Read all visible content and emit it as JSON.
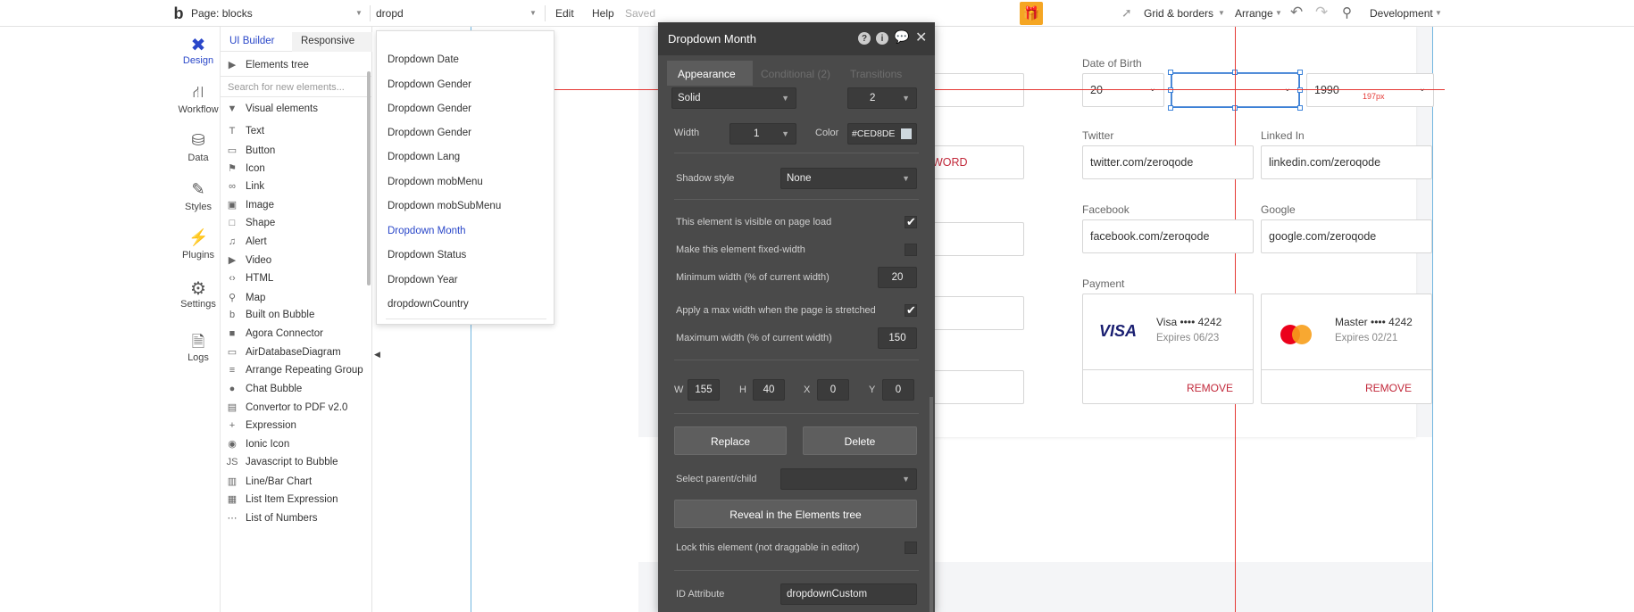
{
  "topbar": {
    "page_label": "Page: blocks",
    "search_value": "dropd",
    "edit": "Edit",
    "help": "Help",
    "saved": "Saved",
    "grid_borders": "Grid & borders",
    "arrange": "Arrange",
    "development": "Development"
  },
  "rail": {
    "items": [
      "Design",
      "Workflow",
      "Data",
      "Styles",
      "Plugins",
      "Settings",
      "Logs"
    ]
  },
  "panel": {
    "tabs": [
      "UI Builder",
      "Responsive"
    ],
    "elements_tree": "Elements tree",
    "search_placeholder": "Search for new elements...",
    "visual_elements": "Visual elements",
    "items": [
      "Text",
      "Button",
      "Icon",
      "Link",
      "Image",
      "Shape",
      "Alert",
      "Video",
      "HTML",
      "Map",
      "Built on Bubble",
      "Agora Connector",
      "AirDatabaseDiagram",
      "Arrange Repeating Group",
      "Chat Bubble",
      "Convertor to PDF v2.0",
      "Expression",
      "Ionic Icon",
      "Javascript to Bubble",
      "Line/Bar Chart",
      "List Item Expression",
      "List of Numbers"
    ]
  },
  "dropdown_list": {
    "items": [
      "Dropdown Date",
      "Dropdown Gender",
      "Dropdown Gender",
      "Dropdown Gender",
      "Dropdown Lang",
      "Dropdown mobMenu",
      "Dropdown mobSubMenu",
      "Dropdown Month",
      "Dropdown Status",
      "Dropdown Year",
      "dropdownCountry"
    ],
    "selected_index": 7
  },
  "canvas": {
    "dob_label": "Date of Birth",
    "dob_day": "20",
    "dob_year": "1990",
    "measure": "197px",
    "password_fragment": "ASSWORD",
    "twitter_label": "Twitter",
    "twitter_value": "twitter.com/zeroqode",
    "linkedin_label": "Linked In",
    "linkedin_value": "linkedin.com/zeroqode",
    "facebook_label": "Facebook",
    "facebook_value": "facebook.com/zeroqode",
    "google_label": "Google",
    "google_value": "google.com/zeroqode",
    "payment_label": "Payment",
    "card1": {
      "brand": "VISA",
      "number": "Visa •••• 4242",
      "expires": "Expires 06/23",
      "action": "REMOVE"
    },
    "card2": {
      "number": "Master •••• 4242",
      "expires": "Expires 02/21",
      "action": "REMOVE"
    }
  },
  "editor": {
    "title": "Dropdown Month",
    "tabs": [
      "Appearance",
      "Conditional (2)",
      "Transitions"
    ],
    "border_style": "Solid",
    "border_num": "2",
    "width_label": "Width",
    "width_value": "1",
    "color_label": "Color",
    "color_value": "#CED8DE",
    "shadow_label": "Shadow style",
    "shadow_value": "None",
    "visible_label": "This element is visible on page load",
    "fixed_label": "Make this element fixed-width",
    "minw_label": "Minimum width (% of current width)",
    "minw_value": "20",
    "maxw_apply_label": "Apply a max width when the page is stretched",
    "maxw_label": "Maximum width (% of current width)",
    "maxw_value": "150",
    "w_label": "W",
    "w_value": "155",
    "h_label": "H",
    "h_value": "40",
    "x_label": "X",
    "x_value": "0",
    "y_label": "Y",
    "y_value": "0",
    "replace": "Replace",
    "delete": "Delete",
    "parent_label": "Select parent/child",
    "reveal": "Reveal in the Elements tree",
    "lock_label": "Lock this element (not draggable in editor)",
    "id_label": "ID Attribute",
    "id_value": "dropdownCustom"
  },
  "colors": {
    "accent": "#2a47c9",
    "remove": "#c2283a",
    "guide": "#e53935",
    "gift": "#f5a623"
  }
}
